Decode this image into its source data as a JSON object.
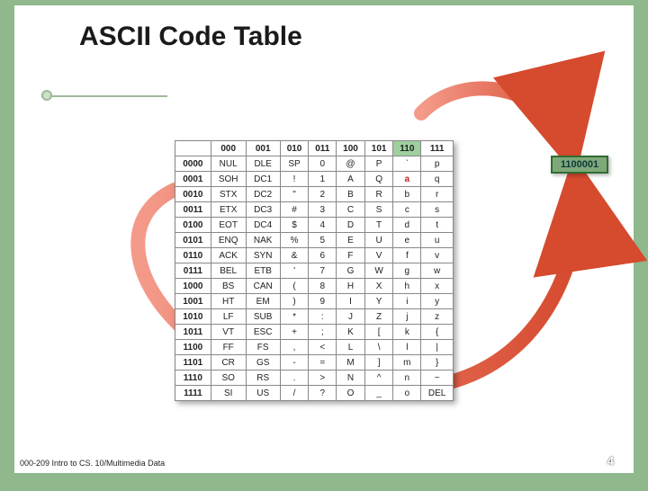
{
  "title": "ASCII Code Table",
  "footer_left": "000-209 Intro to CS. 10/Multimedia Data",
  "page_number": "4",
  "highlight_code": "1100001",
  "highlighted_col_header": "110",
  "highlighted_row_header": "0001",
  "table": {
    "col_headers": [
      "000",
      "001",
      "010",
      "011",
      "100",
      "101",
      "110",
      "111"
    ],
    "row_headers": [
      "0000",
      "0001",
      "0010",
      "0011",
      "0100",
      "0101",
      "0110",
      "0111",
      "1000",
      "1001",
      "1010",
      "1011",
      "1100",
      "1101",
      "1110",
      "1111"
    ],
    "cells": [
      [
        "NUL",
        "DLE",
        "SP",
        "0",
        "@",
        "P",
        "`",
        "p"
      ],
      [
        "SOH",
        "DC1",
        "!",
        "1",
        "A",
        "Q",
        "a",
        "q"
      ],
      [
        "STX",
        "DC2",
        "\"",
        "2",
        "B",
        "R",
        "b",
        "r"
      ],
      [
        "ETX",
        "DC3",
        "#",
        "3",
        "C",
        "S",
        "c",
        "s"
      ],
      [
        "EOT",
        "DC4",
        "$",
        "4",
        "D",
        "T",
        "d",
        "t"
      ],
      [
        "ENQ",
        "NAK",
        "%",
        "5",
        "E",
        "U",
        "e",
        "u"
      ],
      [
        "ACK",
        "SYN",
        "&",
        "6",
        "F",
        "V",
        "f",
        "v"
      ],
      [
        "BEL",
        "ETB",
        "'",
        "7",
        "G",
        "W",
        "g",
        "w"
      ],
      [
        "BS",
        "CAN",
        "(",
        "8",
        "H",
        "X",
        "h",
        "x"
      ],
      [
        "HT",
        "EM",
        ")",
        "9",
        "I",
        "Y",
        "i",
        "y"
      ],
      [
        "LF",
        "SUB",
        "*",
        ":",
        "J",
        "Z",
        "j",
        "z"
      ],
      [
        "VT",
        "ESC",
        "+",
        ";",
        "K",
        "[",
        "k",
        "{"
      ],
      [
        "FF",
        "FS",
        ",",
        "<",
        "L",
        "\\",
        "l",
        "|"
      ],
      [
        "CR",
        "GS",
        "-",
        "=",
        "M",
        "]",
        "m",
        "}"
      ],
      [
        "SO",
        "RS",
        ".",
        ">",
        "N",
        "^",
        "n",
        "~"
      ],
      [
        "SI",
        "US",
        "/",
        "?",
        "O",
        "_",
        "o",
        "DEL"
      ]
    ]
  }
}
